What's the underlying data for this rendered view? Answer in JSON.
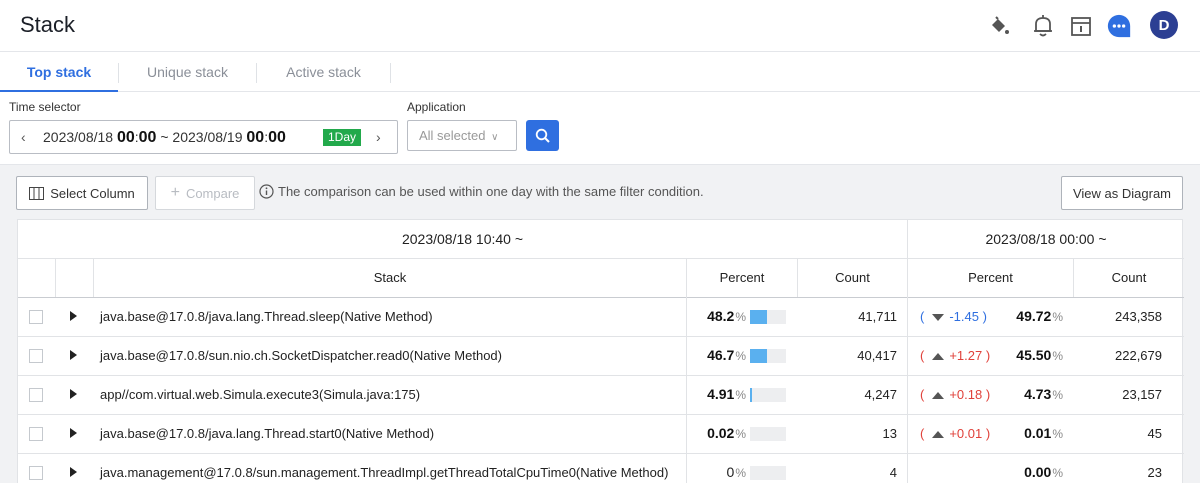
{
  "header": {
    "title": "Stack",
    "icons": [
      "paint-bucket-icon",
      "bell-icon",
      "calendar-icon",
      "chat-icon",
      "user-avatar"
    ],
    "avatar_letter": "D"
  },
  "tabs": [
    {
      "label": "Top stack",
      "active": true
    },
    {
      "label": "Unique stack",
      "active": false
    },
    {
      "label": "Active stack",
      "active": false
    }
  ],
  "filters": {
    "time_label": "Time selector",
    "time_start_date": "2023/08/18",
    "time_start_hour": "00",
    "time_start_min": "00",
    "time_sep": "~",
    "time_end_date": "2023/08/19",
    "time_end_hour": "00",
    "time_end_min": "00",
    "range_badge": "1Day",
    "app_label": "Application",
    "app_value": "All selected"
  },
  "toolbar": {
    "select_column": "Select Column",
    "compare": "Compare",
    "note": "The comparison can be used within one day with the same filter condition.",
    "view_diagram": "View as Diagram"
  },
  "table": {
    "current_time": "2023/08/18 10:40 ~",
    "compare_time": "2023/08/18 00:00 ~",
    "columns": {
      "stack": "Stack",
      "percent": "Percent",
      "count": "Count",
      "cmp_percent": "Percent",
      "cmp_count": "Count"
    },
    "rows": [
      {
        "stack": "java.base@17.0.8/java.lang.Thread.sleep(Native Method)",
        "percent": "48.2",
        "percent_value": 48.2,
        "count": "41,711",
        "delta_dir": "down",
        "delta": "-1.45",
        "cmp_percent": "49.72",
        "cmp_count": "243,358"
      },
      {
        "stack": "java.base@17.0.8/sun.nio.ch.SocketDispatcher.read0(Native Method)",
        "percent": "46.7",
        "percent_value": 46.7,
        "count": "40,417",
        "delta_dir": "up",
        "delta": "+1.27",
        "cmp_percent": "45.50",
        "cmp_count": "222,679"
      },
      {
        "stack": "app//com.virtual.web.Simula.execute3(Simula.java:175)",
        "percent": "4.91",
        "percent_value": 4.91,
        "count": "4,247",
        "delta_dir": "up",
        "delta": "+0.18",
        "cmp_percent": "4.73",
        "cmp_count": "23,157"
      },
      {
        "stack": "java.base@17.0.8/java.lang.Thread.start0(Native Method)",
        "percent": "0.02",
        "percent_value": 0.02,
        "count": "13",
        "delta_dir": "up",
        "delta": "+0.01",
        "cmp_percent": "0.01",
        "cmp_count": "45"
      },
      {
        "stack": "java.management@17.0.8/sun.management.ThreadImpl.getThreadTotalCpuTime0(Native Method)",
        "percent": "0",
        "percent_value": 0,
        "count": "4",
        "delta_dir": "none",
        "delta": "",
        "cmp_percent": "0.00",
        "cmp_count": "23"
      }
    ],
    "percent_unit": "%",
    "bar_color": "#5ab0ef"
  }
}
